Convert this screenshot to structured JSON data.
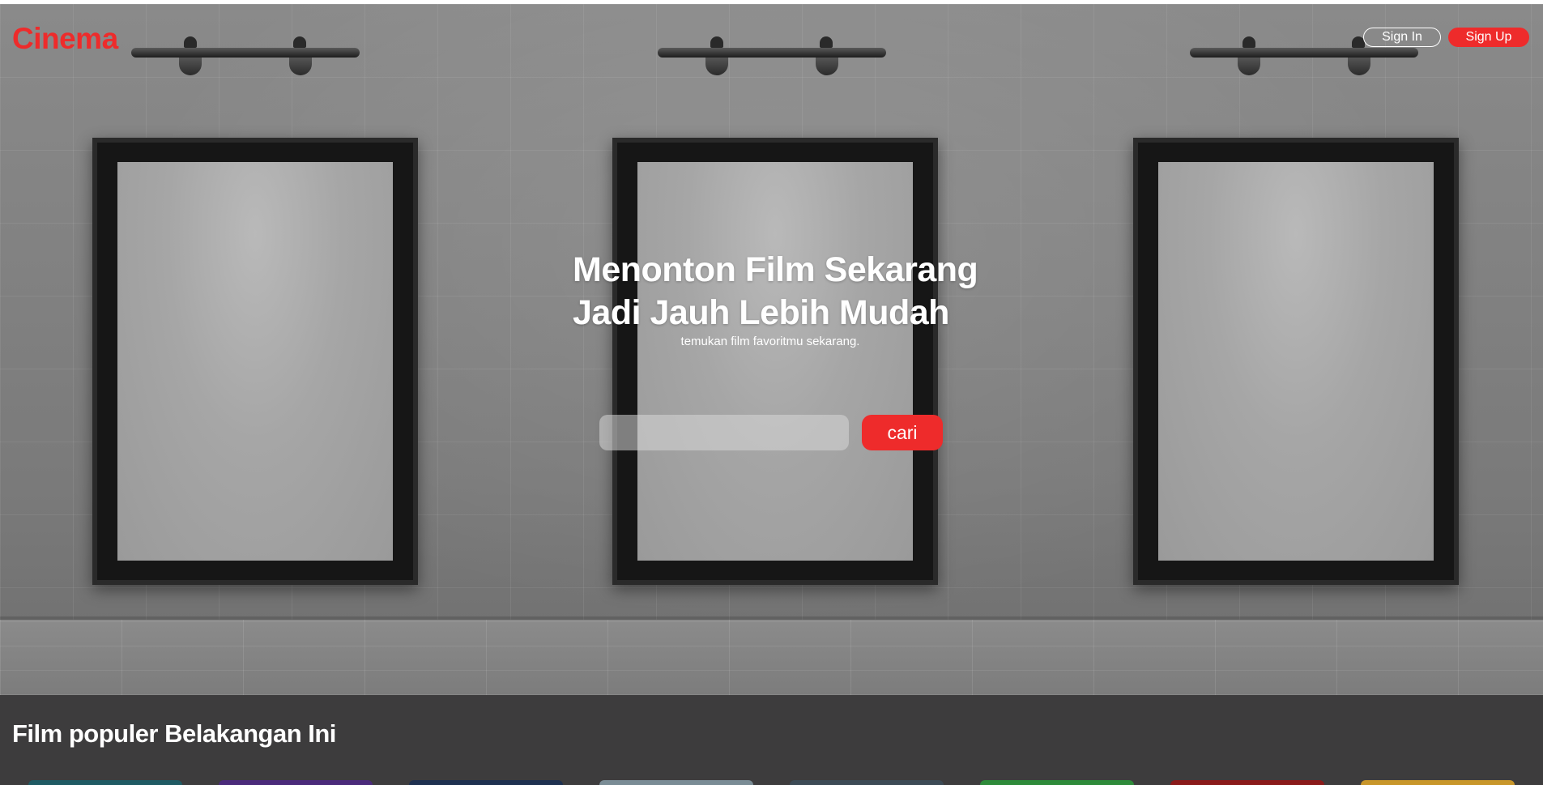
{
  "brand": {
    "logo_text": "Cinema",
    "accent_color": "#ee2b2b"
  },
  "header": {
    "signin_label": "Sign In",
    "signup_label": "Sign Up"
  },
  "hero": {
    "headline_line1": "Menonton Film Sekarang",
    "headline_line2": "Jadi Jauh Lebih Mudah",
    "subheadline": "temukan film favoritmu sekarang.",
    "search": {
      "value": "",
      "placeholder": "",
      "button_label": "cari"
    }
  },
  "popular": {
    "title": "Film populer Belakangan Ini",
    "card_colors": [
      "#1f5a63",
      "#4a2a7a",
      "#1e3050",
      "#7a8c95",
      "#3c4a55",
      "#2e8a3a",
      "#8a1a1a",
      "#c8962a"
    ]
  }
}
